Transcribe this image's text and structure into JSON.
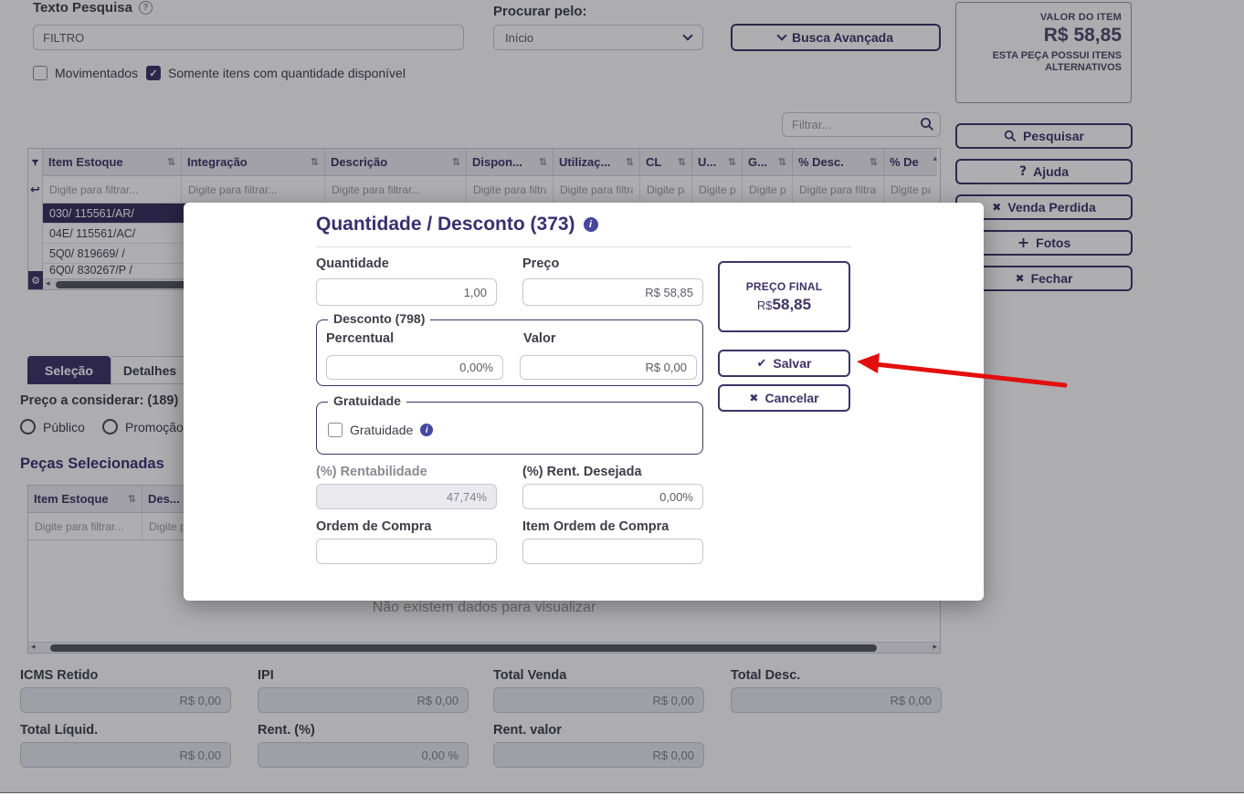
{
  "colors": {
    "primary_purple": "#3e3366",
    "selected_row": "#362d5c",
    "annotation_arrow_red": "#e30e0e"
  },
  "icons": {
    "sort": "⇅",
    "close": "✖",
    "check": "✔",
    "plus": "+",
    "help": "?",
    "question": "?",
    "gear": "⚙",
    "back": "↩",
    "info": "i",
    "scroll_up": "▴",
    "scroll_left": "◂",
    "scroll_right": "▸"
  },
  "header": {
    "texto_pesquisa_label": "Texto Pesquisa",
    "texto_pesquisa_value": "FILTRO",
    "movimentados_label": "Movimentados",
    "somente_itens_label": "Somente itens com quantidade disponível",
    "procurar_pelo_label": "Procurar pelo:",
    "procurar_pelo_value": "Início",
    "busca_avancada_label": "Busca Avançada",
    "filtrar_placeholder": "Filtrar..."
  },
  "valor_item_box": {
    "title": "VALOR DO ITEM",
    "value": "R$ 58,85",
    "note": "ESTA PEÇA POSSUI ITENS ALTERNATIVOS"
  },
  "side_buttons": [
    {
      "icon": "search-icon",
      "label": "Pesquisar"
    },
    {
      "icon": "help-icon",
      "label": "Ajuda"
    },
    {
      "icon": "close-icon",
      "label": "Venda Perdida"
    },
    {
      "icon": "plus-icon",
      "label": "Fotos"
    },
    {
      "icon": "close-icon",
      "label": "Fechar"
    }
  ],
  "stock_table": {
    "columns": [
      "Item Estoque",
      "Integração",
      "Descrição",
      "Dispon...",
      "Utilizaç...",
      "CL",
      "U...",
      "G...",
      "% Desc.",
      "% De"
    ],
    "filter_placeholder": "Digite para filtrar...",
    "rows": [
      "030/ 115561/AR/",
      "04E/ 115561/AC/",
      "5Q0/ 819669/ /",
      "6Q0/ 830267/P /"
    ]
  },
  "tabs": {
    "selecao": "Seleção",
    "detalhes": "Detalhes"
  },
  "preco_considerar": {
    "label": "Preço a considerar: (189)",
    "option_publico": "Público",
    "option_promocao": "Promoção"
  },
  "pecas_selecionadas": {
    "heading": "Peças Selecionadas",
    "col_item_estoque": "Item Estoque",
    "col_descricao": "Des...",
    "filter_placeholder": "Digite para filtrar...",
    "empty_message": "Não existem dados para visualizar"
  },
  "totals": [
    {
      "label": "ICMS Retido",
      "value": "R$ 0,00"
    },
    {
      "label": "IPI",
      "value": "R$ 0,00"
    },
    {
      "label": "Total Venda",
      "value": "R$ 0,00"
    },
    {
      "label": "Total Desc.",
      "value": "R$ 0,00"
    },
    {
      "label": "Total Líquid.",
      "value": "R$ 0,00"
    },
    {
      "label": "Rent. (%)",
      "value": "0,00 %"
    },
    {
      "label": "Rent. valor",
      "value": "R$ 0,00"
    }
  ],
  "modal": {
    "title": "Quantidade / Desconto (373)",
    "quantidade_label": "Quantidade",
    "quantidade_value": "1,00",
    "preco_label": "Preço",
    "preco_value": "R$ 58,85",
    "preco_final_label": "PREÇO FINAL",
    "preco_final_prefix": "R$",
    "preco_final_value": "58,85",
    "desconto_legend": "Desconto (798)",
    "percentual_label": "Percentual",
    "percentual_value": "0,00%",
    "valor_label": "Valor",
    "valor_value": "R$ 0,00",
    "salvar_label": "Salvar",
    "cancelar_label": "Cancelar",
    "gratuidade_legend": "Gratuidade",
    "gratuidade_checkbox_label": "Gratuidade",
    "rentabilidade_label": "(%) Rentabilidade",
    "rentabilidade_value": "47,74%",
    "rent_desejada_label": "(%) Rent. Desejada",
    "rent_desejada_value": "0,00%",
    "ordem_compra_label": "Ordem de Compra",
    "ordem_compra_value": "",
    "item_ordem_compra_label": "Item Ordem de Compra",
    "item_ordem_compra_value": ""
  }
}
